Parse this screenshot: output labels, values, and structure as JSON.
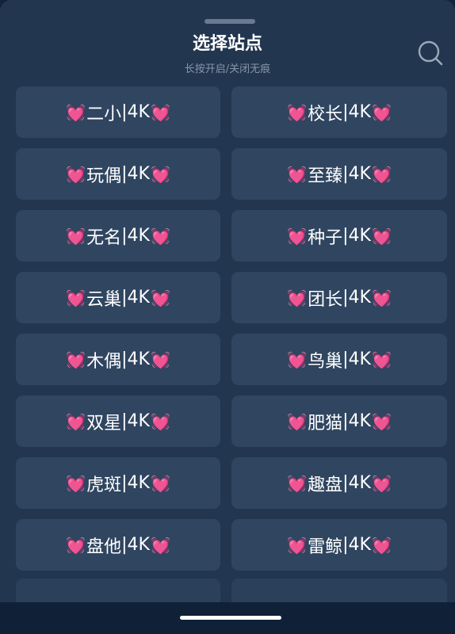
{
  "header": {
    "title": "选择站点",
    "subtitle": "长按开启/关闭无痕"
  },
  "icons": {
    "search": "search-icon",
    "heart": "💓"
  },
  "sites": [
    {
      "name": "二小",
      "tag": "4K"
    },
    {
      "name": "校长",
      "tag": "4K"
    },
    {
      "name": "玩偶",
      "tag": "4K"
    },
    {
      "name": "至臻",
      "tag": "4K"
    },
    {
      "name": "无名",
      "tag": "4K"
    },
    {
      "name": "种子",
      "tag": "4K"
    },
    {
      "name": "云巢",
      "tag": "4K"
    },
    {
      "name": "团长",
      "tag": "4K"
    },
    {
      "name": "木偶",
      "tag": "4K"
    },
    {
      "name": "鸟巢",
      "tag": "4K"
    },
    {
      "name": "双星",
      "tag": "4K"
    },
    {
      "name": "肥猫",
      "tag": "4K"
    },
    {
      "name": "虎斑",
      "tag": "4K"
    },
    {
      "name": "趣盘",
      "tag": "4K"
    },
    {
      "name": "盘他",
      "tag": "4K"
    },
    {
      "name": "雷鲸",
      "tag": "4K"
    }
  ],
  "colors": {
    "sheet_background": "#223650",
    "item_background": "#2f4560",
    "title_text": "#ffffff",
    "subtitle_text": "#8796a8"
  }
}
